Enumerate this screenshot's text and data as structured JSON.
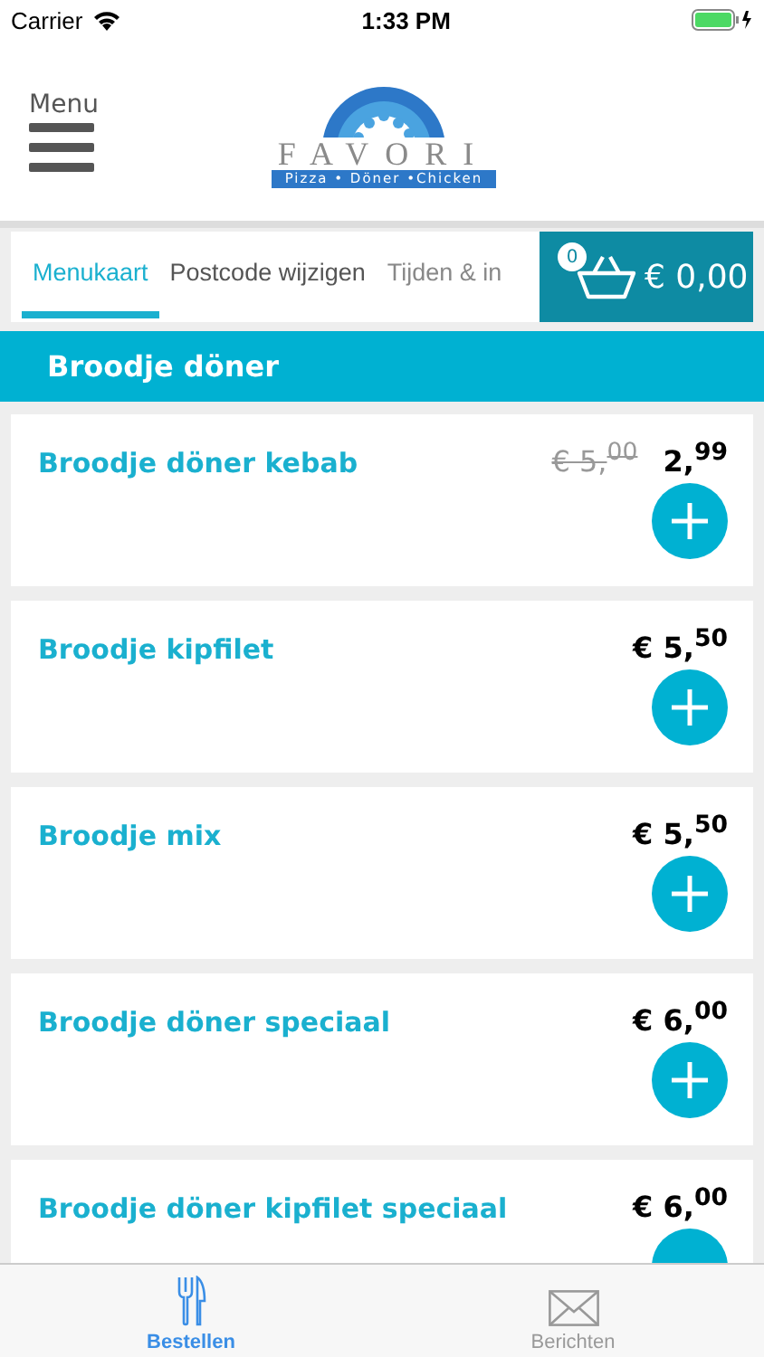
{
  "status_bar": {
    "carrier": "Carrier",
    "time": "1:33 PM"
  },
  "header": {
    "menu_label": "Menu",
    "logo": {
      "name": "FAVORI",
      "tagline": "Pizza • Döner •Chicken"
    }
  },
  "tabs": [
    {
      "label": "Menukaart",
      "selected": true
    },
    {
      "label": "Postcode wijzigen",
      "selected": false
    },
    {
      "label": "Tijden & in",
      "selected": false
    }
  ],
  "cart": {
    "count": "0",
    "total": "€ 0,00"
  },
  "section": {
    "title": "Broodje döner"
  },
  "items": [
    {
      "name": "Broodje döner kebab",
      "old_price": "€ 5,$^{00}$",
      "price": "2,$^{99}$"
    },
    {
      "name": "Broodje kipfilet",
      "price": "€ 5,$^{50}$"
    },
    {
      "name": "Broodje mix",
      "price": "€ 5,$^{50}$"
    },
    {
      "name": "Broodje döner speciaal",
      "price": "€ 6,$^{00}$"
    },
    {
      "name": "Broodje döner kipfilet speciaal",
      "price": "€ 6,$^{00}$"
    }
  ],
  "bottom_tabs": [
    {
      "label": "Bestellen",
      "kind": "cutlery",
      "selected": true
    },
    {
      "label": "Berichten",
      "kind": "mail",
      "selected": false
    }
  ]
}
